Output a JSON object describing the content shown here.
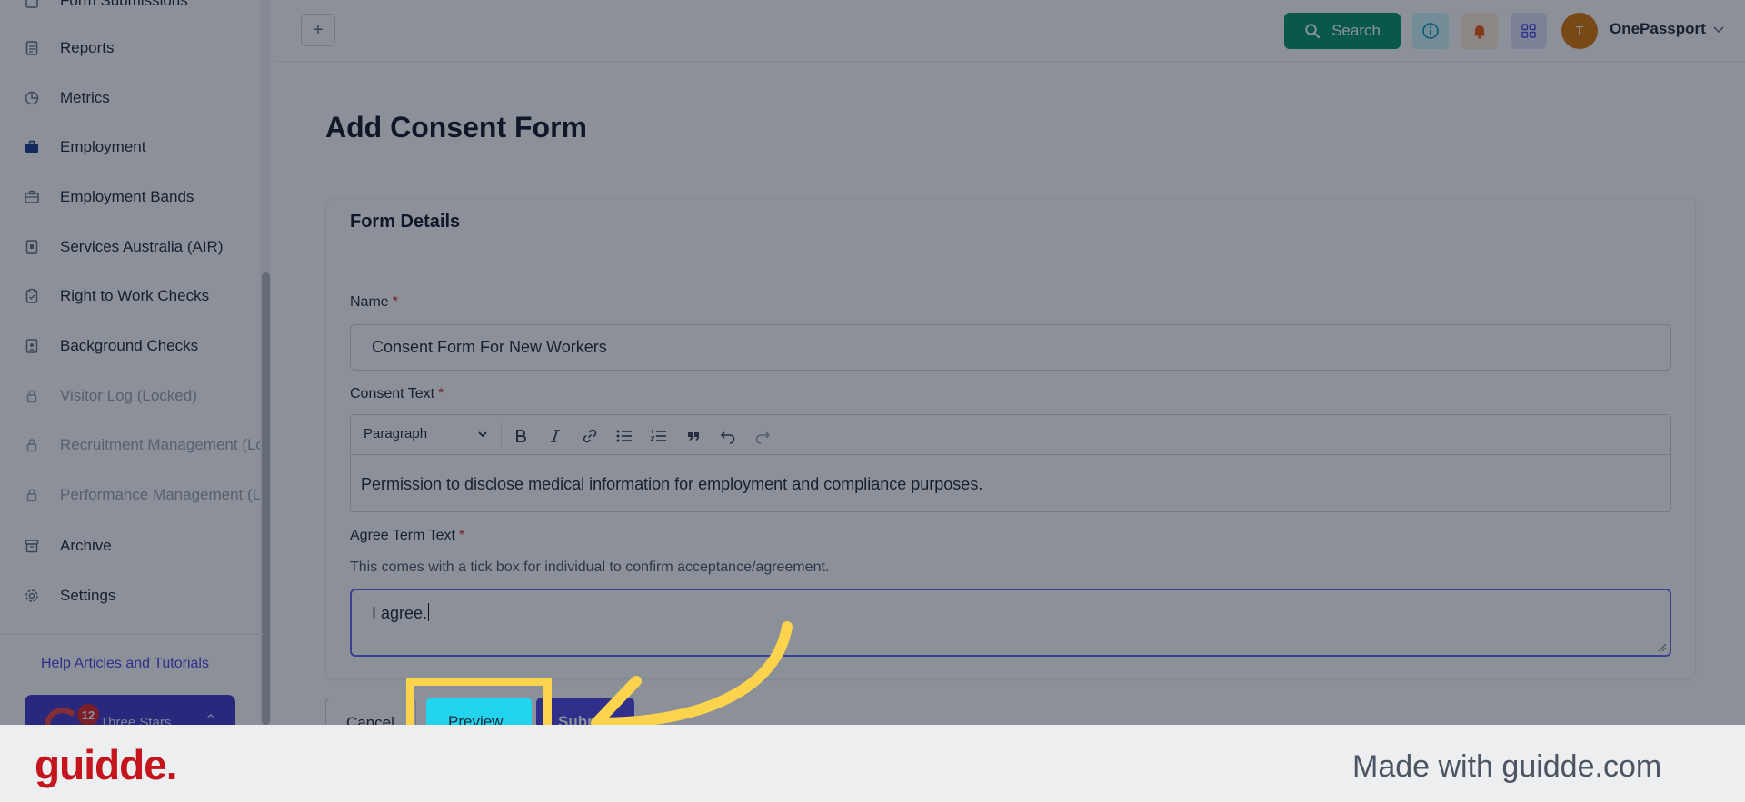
{
  "sidebar": {
    "items": [
      {
        "label": "Form Submissions",
        "icon": "form-icon",
        "locked": false
      },
      {
        "label": "Reports",
        "icon": "document-icon",
        "locked": false
      },
      {
        "label": "Metrics",
        "icon": "pie-chart-icon",
        "locked": false
      },
      {
        "label": "Employment",
        "icon": "briefcase-icon",
        "locked": false
      },
      {
        "label": "Employment Bands",
        "icon": "briefcase-outline-icon",
        "locked": false
      },
      {
        "label": "Services Australia (AIR)",
        "icon": "id-card-icon",
        "locked": false
      },
      {
        "label": "Right to Work Checks",
        "icon": "clipboard-check-icon",
        "locked": false
      },
      {
        "label": "Background Checks",
        "icon": "file-user-icon",
        "locked": false
      },
      {
        "label": "Visitor Log (Locked)",
        "icon": "lock-icon",
        "locked": true
      },
      {
        "label": "Recruitment Management (Lo",
        "icon": "lock-icon",
        "locked": true
      },
      {
        "label": "Performance Management (Lo",
        "icon": "lock-icon",
        "locked": true
      },
      {
        "label": "Archive",
        "icon": "archive-icon",
        "locked": false
      },
      {
        "label": "Settings",
        "icon": "gear-icon",
        "locked": false
      }
    ],
    "help_link": "Help Articles and Tutorials",
    "promo": {
      "badge": "12",
      "text": "Three Stars"
    }
  },
  "header": {
    "add_label": "+",
    "search_label": "Search",
    "avatar_initial": "T",
    "user_name": "OnePassport"
  },
  "page": {
    "title": "Add Consent Form",
    "card_title": "Form Details",
    "name_label": "Name",
    "name_value": "Consent Form For New Workers",
    "consent_label": "Consent Text",
    "editor_format": "Paragraph",
    "consent_value": "Permission to disclose medical information for employment and compliance purposes.",
    "agree_label": "Agree Term Text",
    "agree_help": "This comes with a tick box for individual to confirm acceptance/agreement.",
    "agree_value": "I agree.",
    "required_mark": "*"
  },
  "actions": {
    "cancel": "Cancel",
    "preview": "Preview",
    "submit": "Submit"
  },
  "footer": {
    "brand": "guidde.",
    "made_with": "Made with guidde.com"
  },
  "colors": {
    "primary": "#4f46e5",
    "search": "#059669",
    "preview": "#22d3ee",
    "highlight": "#fcd34d",
    "brand": "#c4141d"
  }
}
